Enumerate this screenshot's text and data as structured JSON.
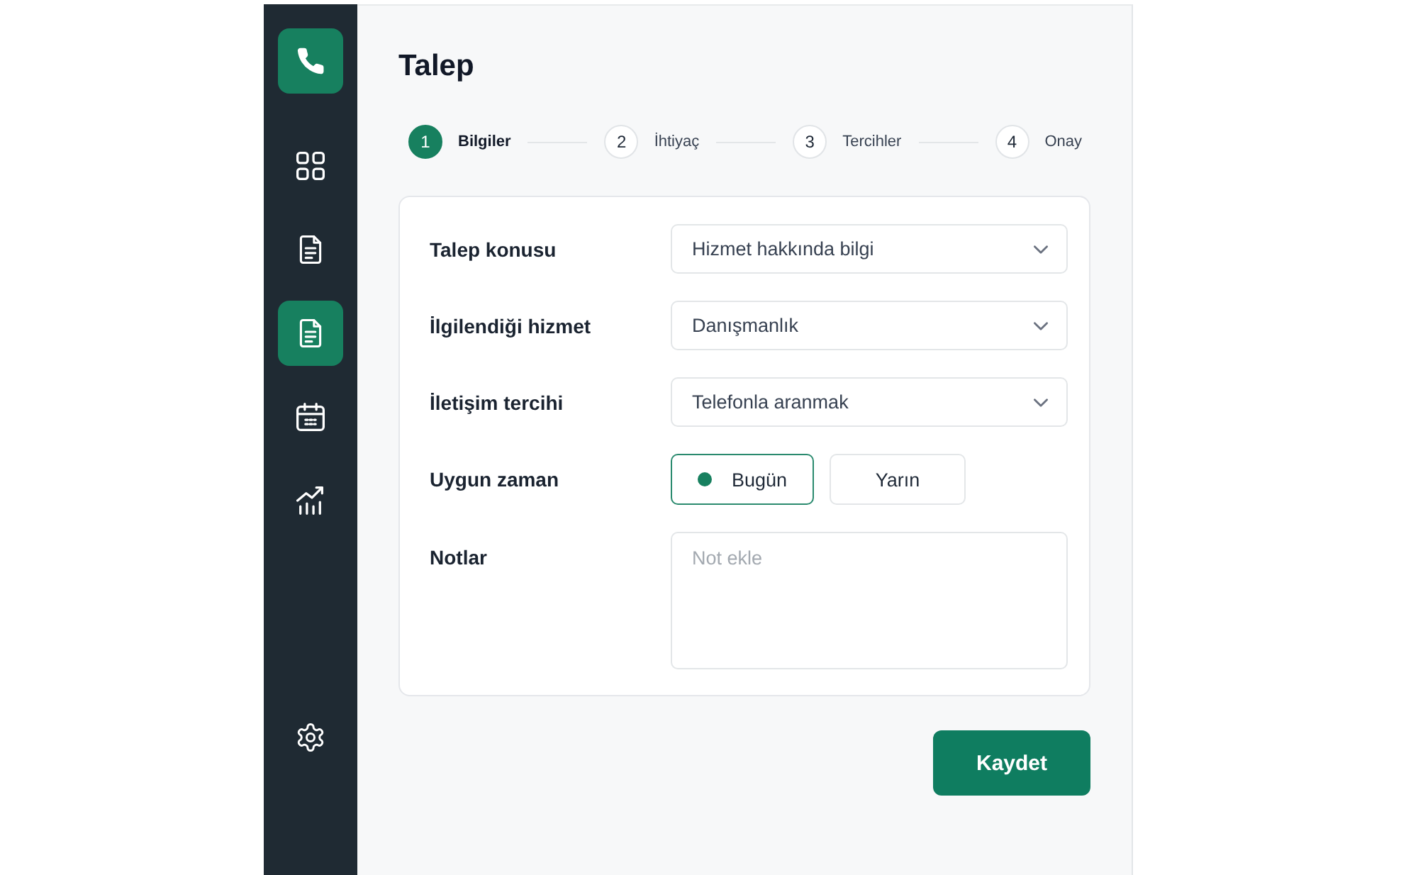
{
  "sidebar": {
    "items": [
      {
        "kind": "grid",
        "selected": false
      },
      {
        "kind": "document",
        "selected": false
      },
      {
        "kind": "document",
        "selected": true
      },
      {
        "kind": "calendar",
        "selected": false
      },
      {
        "kind": "chart",
        "selected": false
      }
    ],
    "footer_items": [
      {
        "kind": "settings",
        "selected": false
      }
    ]
  },
  "page": {
    "title": "Talep"
  },
  "stepper": {
    "steps": [
      {
        "number": "1",
        "label": "Bilgiler",
        "selected": true
      },
      {
        "number": "2",
        "label": "İhtiyaç",
        "selected": false
      },
      {
        "number": "3",
        "label": "Tercihler",
        "selected": false
      },
      {
        "number": "4",
        "label": "Onay",
        "selected": false
      }
    ]
  },
  "form": {
    "fields": [
      {
        "kind": "select",
        "label": "Talep konusu",
        "value": "Hizmet hakkında bilgi"
      },
      {
        "kind": "select",
        "label": "İlgilendiği hizmet",
        "value": "Danışmanlık"
      },
      {
        "kind": "select",
        "label": "İletişim tercihi",
        "value": "Telefonla aranmak"
      },
      {
        "kind": "choice",
        "label": "Uygun zaman",
        "options": [
          {
            "label": "Bugün",
            "selected": true
          },
          {
            "label": "Yarın",
            "selected": false
          }
        ]
      },
      {
        "kind": "textarea",
        "label": "Notlar",
        "placeholder": "Not ekle"
      }
    ]
  },
  "actions": {
    "save_button": {
      "label": "Kaydet"
    }
  }
}
